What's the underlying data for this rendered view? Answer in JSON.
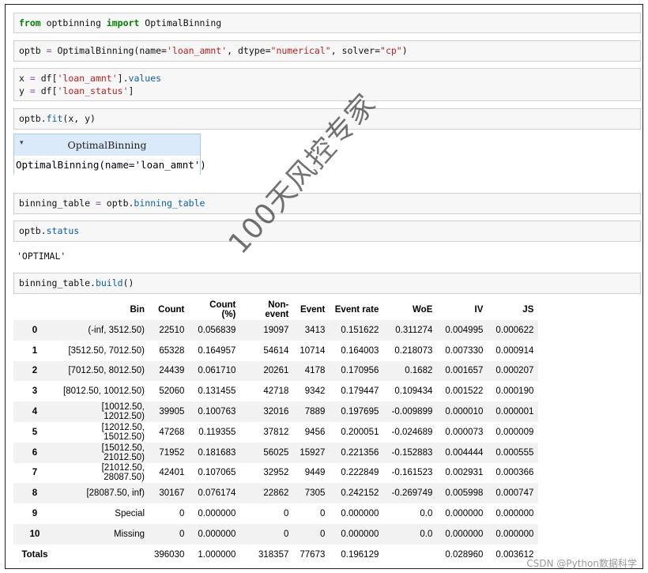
{
  "cells": {
    "c1": {
      "kw1": "from",
      "t1": " optbinning ",
      "kw2": "import",
      "t2": " OptimalBinning"
    },
    "c2": {
      "t1": "optb ",
      "op": "=",
      "t2": " OptimalBinning(name=",
      "s1": "'loan_amnt'",
      "t3": ", dtype=",
      "s2": "\"numerical\"",
      "t4": ", solver=",
      "s3": "\"cp\"",
      "t5": ")"
    },
    "c3": {
      "l1a": "x ",
      "op1": "=",
      "l1b": " df[",
      "s1": "'loan_amnt'",
      "l1c": "].",
      "a1": "values",
      "l2a": "y ",
      "op2": "=",
      "l2b": " df[",
      "s2": "'loan_status'",
      "l2c": "]"
    },
    "c4": {
      "t1": "optb.",
      "a1": "fit",
      "t2": "(x, y)"
    },
    "c5": {
      "t1": "binning_table ",
      "op": "=",
      "t2": " optb.",
      "a1": "binning_table"
    },
    "c6": {
      "t1": "optb.",
      "a1": "status"
    },
    "c7": {
      "t1": "binning_table.",
      "a1": "build",
      "t2": "()"
    }
  },
  "widget": {
    "arrow": "▾",
    "title": "OptimalBinning",
    "body": "OptimalBinning(name='loan_amnt')"
  },
  "status_output": "'OPTIMAL'",
  "table": {
    "columns": [
      "Bin",
      "Count",
      "Count (%)",
      "Non-event",
      "Event",
      "Event rate",
      "WoE",
      "IV",
      "JS"
    ],
    "rows": [
      {
        "idx": "0",
        "cells": [
          "(-inf, 3512.50)",
          "22510",
          "0.056839",
          "19097",
          "3413",
          "0.151622",
          "0.311274",
          "0.004995",
          "0.000622"
        ]
      },
      {
        "idx": "1",
        "cells": [
          "[3512.50, 7012.50)",
          "65328",
          "0.164957",
          "54614",
          "10714",
          "0.164003",
          "0.218073",
          "0.007330",
          "0.000914"
        ]
      },
      {
        "idx": "2",
        "cells": [
          "[7012.50, 8012.50)",
          "24439",
          "0.061710",
          "20261",
          "4178",
          "0.170956",
          "0.1682",
          "0.001657",
          "0.000207"
        ]
      },
      {
        "idx": "3",
        "cells": [
          "[8012.50, 10012.50)",
          "52060",
          "0.131455",
          "42718",
          "9342",
          "0.179447",
          "0.109434",
          "0.001522",
          "0.000190"
        ]
      },
      {
        "idx": "4",
        "cells": [
          "[10012.50, 12012.50)",
          "39905",
          "0.100763",
          "32016",
          "7889",
          "0.197695",
          "-0.009899",
          "0.000010",
          "0.000001"
        ]
      },
      {
        "idx": "5",
        "cells": [
          "[12012.50, 15012.50)",
          "47268",
          "0.119355",
          "37812",
          "9456",
          "0.200051",
          "-0.024689",
          "0.000073",
          "0.000009"
        ]
      },
      {
        "idx": "6",
        "cells": [
          "[15012.50, 21012.50)",
          "71952",
          "0.181683",
          "56025",
          "15927",
          "0.221356",
          "-0.152883",
          "0.004444",
          "0.000555"
        ]
      },
      {
        "idx": "7",
        "cells": [
          "[21012.50, 28087.50)",
          "42401",
          "0.107065",
          "32952",
          "9449",
          "0.222849",
          "-0.161523",
          "0.002931",
          "0.000366"
        ]
      },
      {
        "idx": "8",
        "cells": [
          "[28087.50, inf)",
          "30167",
          "0.076174",
          "22862",
          "7305",
          "0.242152",
          "-0.269749",
          "0.005998",
          "0.000747"
        ]
      },
      {
        "idx": "9",
        "cells": [
          "Special",
          "0",
          "0.000000",
          "0",
          "0",
          "0.000000",
          "0.0",
          "0.000000",
          "0.000000"
        ]
      },
      {
        "idx": "10",
        "cells": [
          "Missing",
          "0",
          "0.000000",
          "0",
          "0",
          "0.000000",
          "0.0",
          "0.000000",
          "0.000000"
        ]
      }
    ],
    "totals": {
      "idx": "Totals",
      "cells": [
        "",
        "396030",
        "1.000000",
        "318357",
        "77673",
        "0.196129",
        "",
        "0.028960",
        "0.003612"
      ]
    }
  },
  "watermark": "100天风控专家",
  "credit": "CSDN @Python数据科学"
}
